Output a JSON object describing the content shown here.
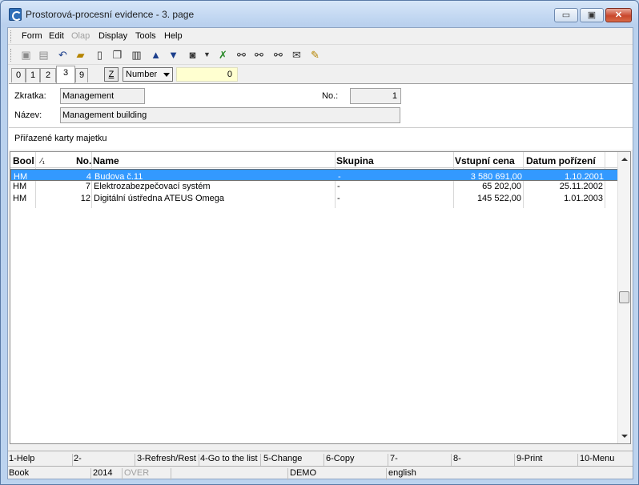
{
  "window": {
    "title": "Prostorová-procesní evidence - 3. page",
    "min_glyph": "▭",
    "max_glyph": "▣",
    "close_glyph": "✕"
  },
  "menu": [
    "Form",
    "Edit",
    "Olap",
    "Display",
    "Tools",
    "Help"
  ],
  "toolbar_icons": [
    "save-icon",
    "save-all-icon",
    "undo-icon",
    "open-folder-icon",
    "new-document-icon",
    "copy-document-icon",
    "book-icon",
    "arrow-up-icon",
    "arrow-down-icon",
    "camera-icon",
    "dropdown-icon",
    "filter-icon",
    "binoculars-icon",
    "binoculars-next-icon",
    "binoculars-prev-icon",
    "mail-icon",
    "edit-note-icon"
  ],
  "tabs": [
    "0",
    "1",
    "2",
    "3",
    "9"
  ],
  "z_button": "Z",
  "sort_select": "Number",
  "number_value": "0",
  "form": {
    "zkratka_label": "Zkratka:",
    "zkratka_value": "Management",
    "no_label": "No.:",
    "no_value": "1",
    "nazev_label": "Název:",
    "nazev_value": "Management building"
  },
  "section_title": "Přiřazené karty majetku",
  "grid": {
    "headers": {
      "book": "Bool",
      "sort": "⁄₁",
      "no": "No.",
      "name": "Name",
      "skupina": "Skupina",
      "cena": "Vstupní cena",
      "datum": "Datum pořízení"
    },
    "rows": [
      {
        "book": "HM",
        "no": "4",
        "name": "Budova č.11",
        "skupina": "-",
        "cena": "3 580 691,00",
        "datum": "1.10.2001"
      },
      {
        "book": "HM",
        "no": "7",
        "name": "Elektrozabezpečovací systém",
        "skupina": "-",
        "cena": "65 202,00",
        "datum": "25.11.2002"
      },
      {
        "book": "HM",
        "no": "12",
        "name": "Digitální ústředna ATEUS Omega",
        "skupina": "-",
        "cena": "145 522,00",
        "datum": "1.01.2003"
      }
    ]
  },
  "fkeys": [
    "1-Help",
    "2-",
    "3-Refresh/Rest",
    "4-Go to the list",
    "5-Change",
    "6-Copy",
    "7-",
    "8-",
    "9-Print",
    "10-Menu"
  ],
  "status": [
    "Book",
    "2014",
    "OVER",
    "",
    "DEMO",
    "english"
  ]
}
